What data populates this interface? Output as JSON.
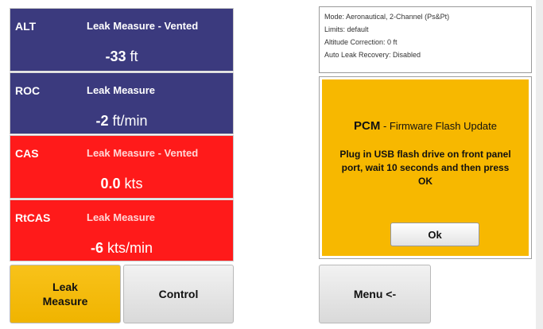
{
  "panels": [
    {
      "name": "ALT",
      "status": "Leak Measure - Vented",
      "value": "-33",
      "unit": " ft",
      "color": "#3b3a7e"
    },
    {
      "name": "ROC",
      "status": "Leak Measure",
      "value": "-2",
      "unit": " ft/min",
      "color": "#3b3a7e"
    },
    {
      "name": "CAS",
      "status": "Leak Measure - Vented",
      "value": "0.0",
      "unit": " kts",
      "color": "#ff1a1a"
    },
    {
      "name": "RtCAS",
      "status": "Leak Measure",
      "value": "-6",
      "unit": " kts/min",
      "color": "#ff1a1a"
    }
  ],
  "bottom_buttons": {
    "leak_measure": "Leak\nMeasure",
    "control": "Control",
    "menu": "Menu <-"
  },
  "info": {
    "mode": "Mode: Aeronautical, 2-Channel (Ps&Pt)",
    "limits": "Limits: default",
    "altitude_correction": "Altitude Correction: 0 ft",
    "auto_leak": "Auto Leak Recovery: Disabled"
  },
  "dialog": {
    "brand": "PCM",
    "title": " - Firmware Flash Update",
    "message": "Plug in USB flash drive on front panel port, wait 10 seconds and then press OK",
    "ok_label": "Ok",
    "background": "#f7b800"
  }
}
